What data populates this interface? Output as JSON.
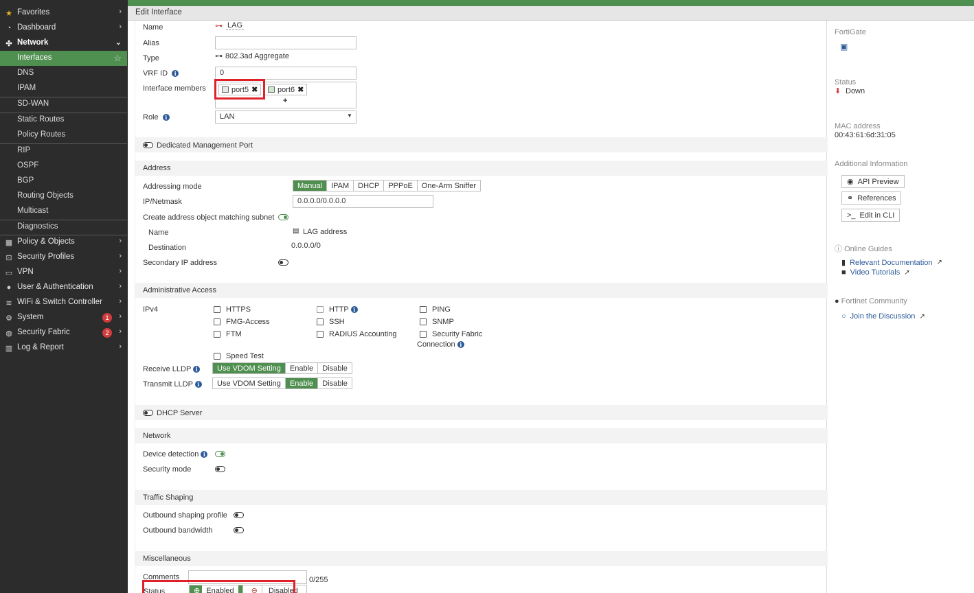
{
  "sidebar": {
    "items": [
      {
        "label": "Favorites",
        "icon": "star-icon",
        "glyph": "★"
      },
      {
        "label": "Dashboard",
        "icon": "dashboard-icon",
        "glyph": "◔"
      },
      {
        "label": "Network",
        "icon": "network-icon",
        "glyph": "✣"
      },
      {
        "label": "Interfaces"
      },
      {
        "label": "DNS"
      },
      {
        "label": "IPAM"
      },
      {
        "label": "SD-WAN"
      },
      {
        "label": "Static Routes"
      },
      {
        "label": "Policy Routes"
      },
      {
        "label": "RIP"
      },
      {
        "label": "OSPF"
      },
      {
        "label": "BGP"
      },
      {
        "label": "Routing Objects"
      },
      {
        "label": "Multicast"
      },
      {
        "label": "Diagnostics"
      },
      {
        "label": "Policy & Objects",
        "icon": "policy-icon",
        "glyph": "▦"
      },
      {
        "label": "Security Profiles",
        "icon": "lock-icon",
        "glyph": "🔒"
      },
      {
        "label": "VPN",
        "icon": "vpn-icon",
        "glyph": "▭"
      },
      {
        "label": "User & Authentication",
        "icon": "user-icon",
        "glyph": "👤"
      },
      {
        "label": "WiFi & Switch Controller",
        "icon": "wifi-icon",
        "glyph": "≋"
      },
      {
        "label": "System",
        "icon": "gear-icon",
        "glyph": "⚙",
        "badge": "1"
      },
      {
        "label": "Security Fabric",
        "icon": "fabric-icon",
        "glyph": "◍",
        "badge": "2"
      },
      {
        "label": "Log & Report",
        "icon": "chart-icon",
        "glyph": "▥"
      }
    ]
  },
  "header": {
    "title": "Edit Interface"
  },
  "form": {
    "name_label": "Name",
    "name_value": "LAG",
    "alias_label": "Alias",
    "alias_value": "",
    "type_label": "Type",
    "type_value": "802.3ad Aggregate",
    "vrf_label": "VRF ID",
    "vrf_value": "0",
    "members_label": "Interface members",
    "members": [
      "port5",
      "port6"
    ],
    "add_glyph": "+",
    "role_label": "Role",
    "role_value": "LAN",
    "dedicated_mgmt": "Dedicated Management Port"
  },
  "address": {
    "section": "Address",
    "mode_label": "Addressing mode",
    "modes": [
      "Manual",
      "IPAM",
      "DHCP",
      "PPPoE",
      "One-Arm Sniffer"
    ],
    "ip_label": "IP/Netmask",
    "ip_value": "0.0.0.0/0.0.0.0",
    "create_obj_label": "Create address object matching subnet",
    "obj_name_label": "Name",
    "obj_name_value": "LAG address",
    "dest_label": "Destination",
    "dest_value": "0.0.0.0/0",
    "secondary_label": "Secondary IP address"
  },
  "admin": {
    "section": "Administrative Access",
    "ipv4_label": "IPv4",
    "col1": [
      "HTTPS",
      "FMG-Access",
      "FTM"
    ],
    "col2": [
      "HTTP",
      "SSH",
      "RADIUS Accounting"
    ],
    "col3": [
      "PING",
      "SNMP",
      "Security Fabric"
    ],
    "col3_wrap": "Connection",
    "speed_test": "Speed Test",
    "receive_lldp_label": "Receive LLDP",
    "transmit_lldp_label": "Transmit LLDP",
    "lldp_options": [
      "Use VDOM Setting",
      "Enable",
      "Disable"
    ]
  },
  "dhcp": {
    "label": "DHCP Server"
  },
  "network": {
    "section": "Network",
    "device_detection": "Device detection",
    "security_mode": "Security mode"
  },
  "traffic": {
    "section": "Traffic Shaping",
    "outbound_profile": "Outbound shaping profile",
    "outbound_bandwidth": "Outbound bandwidth"
  },
  "misc": {
    "section": "Miscellaneous",
    "comments_label": "Comments",
    "comments_count": "0/255",
    "status_label": "Status",
    "status_options": [
      "Enabled",
      "Disabled"
    ]
  },
  "right": {
    "device_label": "FortiGate",
    "status_label": "Status",
    "status_value": "Down",
    "mac_label": "MAC address",
    "mac_value": "00:43:61:6d:31:05",
    "additional_label": "Additional Information",
    "buttons": [
      "API Preview",
      "References",
      "Edit in CLI"
    ],
    "guides_label": "Online Guides",
    "guides": [
      "Relevant Documentation",
      "Video Tutorials"
    ],
    "community_label": "Fortinet Community",
    "community_link": "Join the Discussion"
  },
  "colors": {
    "accent": "#4f8f4f",
    "highlight": "#e0202a",
    "link": "#2d5b9a"
  }
}
